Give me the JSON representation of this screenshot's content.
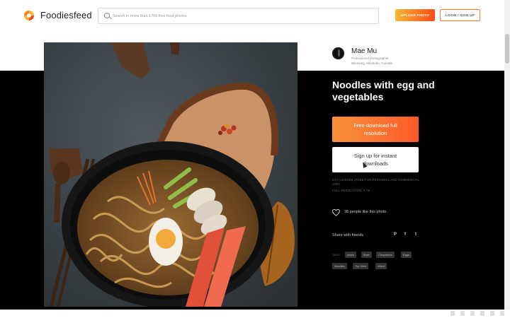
{
  "header": {
    "brand": "Foodiesfeed",
    "search_placeholder": "Search in more than 1700 free food photos",
    "upload_label": "UPLOAD PHOTO",
    "login_label": "LOGIN / SIGN UP"
  },
  "author": {
    "name": "Mae Mu",
    "title": "Professional photographer",
    "location": "Winnipeg, Manitoba, Canada"
  },
  "photo": {
    "title": "Noodles with egg and vegetables",
    "download_label": "Free download full resolution",
    "signup_label": "Sign up for instant downloads",
    "license": "CC0 LICENSE (FREE FOR PERSONAL AND COMMERCIAL USE)",
    "resolution": "FULL RESOLUTION: 5 7K",
    "likes": "38 people like this photo."
  },
  "share": {
    "label": "Share with friends",
    "icons": [
      "P",
      "f",
      "t"
    ]
  },
  "tags": {
    "label": "TAGS:",
    "items": [
      "Asian",
      "Bowl",
      "Chopsticks",
      "Eggs",
      "Noodles",
      "Top View",
      "Wood"
    ]
  },
  "colors": {
    "accent_start": "#f7b733",
    "accent_end": "#fc4a1a",
    "band": "#000000"
  }
}
